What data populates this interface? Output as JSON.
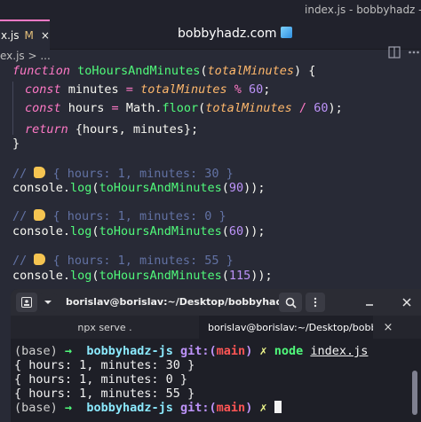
{
  "window": {
    "title": "index.js - bobbyhadz - V"
  },
  "tab": {
    "label": "x.js",
    "modified": "M",
    "close": "×"
  },
  "brand": {
    "text": "bobbyhadz.com"
  },
  "breadcrumb": {
    "text": "ex.js > ..."
  },
  "code": {
    "l1": {
      "kw": "function",
      "name": "toHoursAndMinutes",
      "open": "(",
      "param": "totalMinutes",
      "close": ") {"
    },
    "l2": {
      "kw": "const",
      "name": " minutes ",
      "eq": "=",
      "sp": " ",
      "param": "totalMinutes",
      "mod": " % ",
      "num": "60",
      "end": ";"
    },
    "l3": {
      "kw": "const",
      "name": " hours ",
      "eq": "=",
      "obj": " Math.",
      "fn": "floor",
      "open": "(",
      "param": "totalMinutes",
      "div": " / ",
      "num": "60",
      "end": ");"
    },
    "l4": {
      "kw": "return",
      "body": " {hours, minutes};"
    },
    "l5": {
      "text": "}"
    },
    "c1": {
      "prefix": "// ",
      "text": " { hours: 1, minutes: 30 }"
    },
    "log1": {
      "obj": "console.",
      "fn": "log",
      "open": "(",
      "call": "toHoursAndMinutes",
      "arg_open": "(",
      "num": "90",
      "end": "));"
    },
    "c2": {
      "prefix": "// ",
      "text": " { hours: 1, minutes: 0 }"
    },
    "log2": {
      "obj": "console.",
      "fn": "log",
      "open": "(",
      "call": "toHoursAndMinutes",
      "arg_open": "(",
      "num": "60",
      "end": "));"
    },
    "c3": {
      "prefix": "// ",
      "text": " { hours: 1, minutes: 55 }"
    },
    "log3": {
      "obj": "console.",
      "fn": "log",
      "open": "(",
      "call": "toHoursAndMinutes",
      "arg_open": "(",
      "num": "115",
      "end": "));"
    }
  },
  "terminal": {
    "title": "borislav@borislav:~/Desktop/bobbyhadz-r...",
    "tabs": [
      {
        "label": "npx serve ."
      },
      {
        "label": "borislav@borislav:~/Desktop/bobbyhadz-r..."
      }
    ],
    "prompt": {
      "base": "(base)",
      "arrow": "→",
      "dir": "bobbyhadz-js",
      "git": "git:",
      "branch_open": "(",
      "branch": "main",
      "branch_close": ")",
      "dirty": "✗"
    },
    "command": {
      "cmd": "node",
      "arg": "index.js"
    },
    "output": [
      "{ hours: 1, minutes: 30 }",
      "{ hours: 1, minutes: 0 }",
      "{ hours: 1, minutes: 55 }"
    ]
  },
  "colors": {
    "editor_bg": "#282a36",
    "keyword": "#ff79c6",
    "function": "#50fa7b",
    "param": "#ffb86c",
    "number": "#bd93f9",
    "comment": "#6272a4"
  },
  "icons": [
    "cube-icon",
    "split-editor-icon",
    "more-icon",
    "terminal-icon",
    "chevron-down-icon",
    "search-icon",
    "menu-icon",
    "minimize-icon",
    "close-icon",
    "pointing-down-emoji"
  ]
}
